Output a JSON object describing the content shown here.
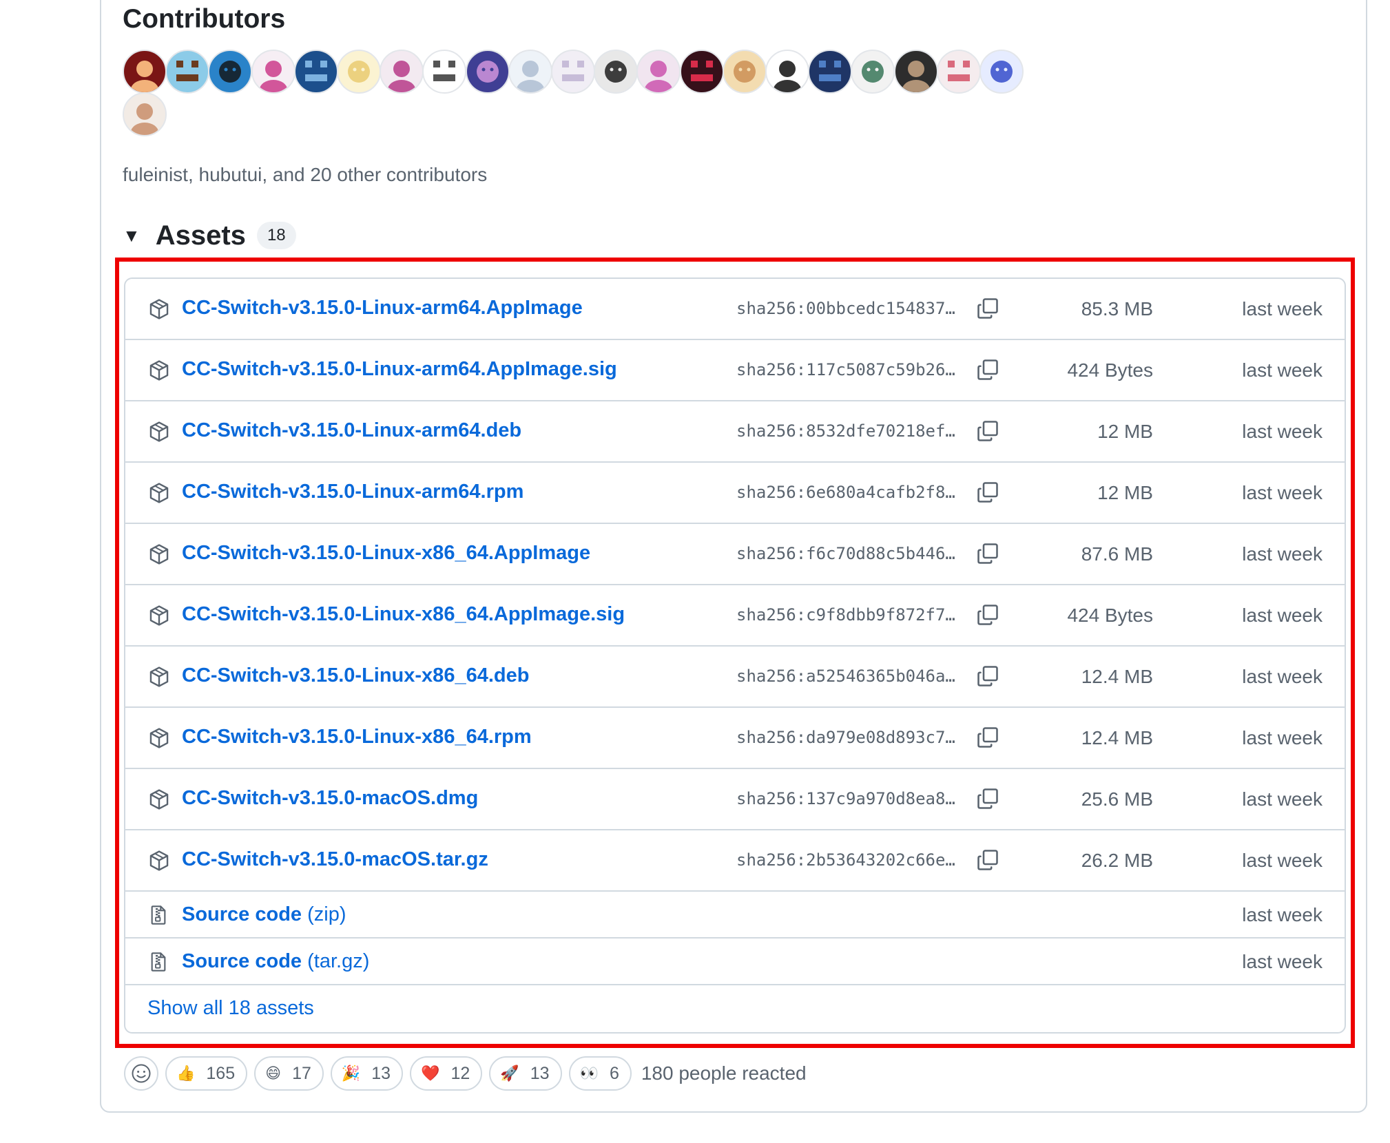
{
  "contributors": {
    "title": "Contributors",
    "summary": "fuleinist, hubutui, and 20 other contributors",
    "avatars": [
      {
        "bg": "#7a1515",
        "fg": "#f3b27a"
      },
      {
        "bg": "#8ccbe8",
        "fg": "#6b3b1f"
      },
      {
        "bg": "#2a83c9",
        "fg": "#111111"
      },
      {
        "bg": "#f6eef4",
        "fg": "#d2569a"
      },
      {
        "bg": "#1c4f8c",
        "fg": "#7db2e0"
      },
      {
        "bg": "#fbf3d2",
        "fg": "#e9c86a"
      },
      {
        "bg": "#f3eaf1",
        "fg": "#c05598"
      },
      {
        "bg": "#ffffff",
        "fg": "#555555"
      },
      {
        "bg": "#3f3f94",
        "fg": "#d99ae0"
      },
      {
        "bg": "#eef3f8",
        "fg": "#b8c6d8"
      },
      {
        "bg": "#f1eef5",
        "fg": "#c7bcd8"
      },
      {
        "bg": "#e8e8e8",
        "fg": "#111111"
      },
      {
        "bg": "#f1e5f0",
        "fg": "#d16ab8"
      },
      {
        "bg": "#36101a",
        "fg": "#d72c4a"
      },
      {
        "bg": "#f3dcb0",
        "fg": "#c98b4f"
      },
      {
        "bg": "#ffffff",
        "fg": "#333333"
      },
      {
        "bg": "#1f3566",
        "fg": "#4f7fc6"
      },
      {
        "bg": "#f2f2f2",
        "fg": "#2c6e4f"
      },
      {
        "bg": "#2d2d2d",
        "fg": "#b09377"
      },
      {
        "bg": "#f5ecee",
        "fg": "#d96a7c"
      },
      {
        "bg": "#e6ecff",
        "fg": "#2b44c8"
      },
      {
        "bg": "#f2ebe5",
        "fg": "#cf9c7d"
      }
    ]
  },
  "assets": {
    "title": "Assets",
    "count": "18",
    "rows": [
      {
        "name": "CC-Switch-v3.15.0-Linux-arm64.AppImage",
        "sha": "sha256:00bbcedc154837…",
        "size": "85.3 MB",
        "date": "last week"
      },
      {
        "name": "CC-Switch-v3.15.0-Linux-arm64.AppImage.sig",
        "sha": "sha256:117c5087c59b26…",
        "size": "424 Bytes",
        "date": "last week"
      },
      {
        "name": "CC-Switch-v3.15.0-Linux-arm64.deb",
        "sha": "sha256:8532dfe70218ef…",
        "size": "12 MB",
        "date": "last week"
      },
      {
        "name": "CC-Switch-v3.15.0-Linux-arm64.rpm",
        "sha": "sha256:6e680a4cafb2f8…",
        "size": "12 MB",
        "date": "last week"
      },
      {
        "name": "CC-Switch-v3.15.0-Linux-x86_64.AppImage",
        "sha": "sha256:f6c70d88c5b446…",
        "size": "87.6 MB",
        "date": "last week"
      },
      {
        "name": "CC-Switch-v3.15.0-Linux-x86_64.AppImage.sig",
        "sha": "sha256:c9f8dbb9f872f7…",
        "size": "424 Bytes",
        "date": "last week"
      },
      {
        "name": "CC-Switch-v3.15.0-Linux-x86_64.deb",
        "sha": "sha256:a52546365b046a…",
        "size": "12.4 MB",
        "date": "last week"
      },
      {
        "name": "CC-Switch-v3.15.0-Linux-x86_64.rpm",
        "sha": "sha256:da979e08d893c7…",
        "size": "12.4 MB",
        "date": "last week"
      },
      {
        "name": "CC-Switch-v3.15.0-macOS.dmg",
        "sha": "sha256:137c9a970d8ea8…",
        "size": "25.6 MB",
        "date": "last week"
      },
      {
        "name": "CC-Switch-v3.15.0-macOS.tar.gz",
        "sha": "sha256:2b53643202c66e…",
        "size": "26.2 MB",
        "date": "last week"
      }
    ],
    "source_rows": [
      {
        "label": "Source code",
        "suffix": "(zip)",
        "date": "last week"
      },
      {
        "label": "Source code",
        "suffix": "(tar.gz)",
        "date": "last week"
      }
    ],
    "show_all": "Show all 18 assets"
  },
  "reactions": {
    "items": [
      {
        "emoji": "👍",
        "count": "165",
        "name": "thumbs-up"
      },
      {
        "emoji": "😄",
        "count": "17",
        "name": "laugh"
      },
      {
        "emoji": "🎉",
        "count": "13",
        "name": "hooray"
      },
      {
        "emoji": "❤️",
        "count": "12",
        "name": "heart"
      },
      {
        "emoji": "🚀",
        "count": "13",
        "name": "rocket"
      },
      {
        "emoji": "👀",
        "count": "6",
        "name": "eyes"
      }
    ],
    "summary": "180 people reacted"
  },
  "colors": {
    "link": "#0969da",
    "muted": "#59636e",
    "border": "#d1d9e0",
    "highlight": "#ee0000"
  },
  "icons": {
    "asset": "package-icon",
    "source": "file-zip-icon",
    "copy": "copy-icon",
    "caret": "triangle-down-icon",
    "react": "smiley-icon"
  }
}
